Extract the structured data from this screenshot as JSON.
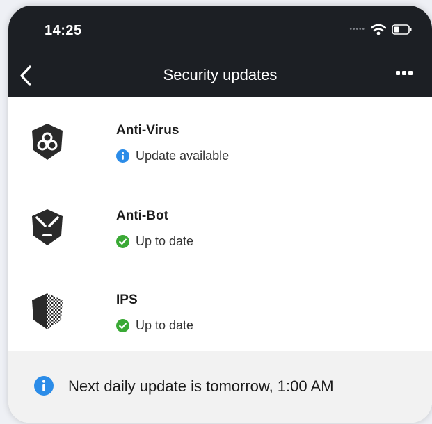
{
  "status_bar": {
    "time": "14:25"
  },
  "header": {
    "title": "Security updates"
  },
  "items": [
    {
      "name": "Anti-Virus",
      "status": "Update available",
      "status_kind": "info",
      "icon": "biohazard-shield-icon"
    },
    {
      "name": "Anti-Bot",
      "status": "Up to date",
      "status_kind": "ok",
      "icon": "bot-face-shield-icon"
    },
    {
      "name": "IPS",
      "status": "Up to date",
      "status_kind": "ok",
      "icon": "checkered-shield-icon"
    }
  ],
  "footer": {
    "text": "Next daily update is tomorrow, 1:00 AM"
  },
  "colors": {
    "header_bg": "#1c1f24",
    "info_blue": "#2b8ce8",
    "ok_green": "#3aa935",
    "icon_dark": "#2a2a2a",
    "footer_bg": "#f2f2f2"
  }
}
